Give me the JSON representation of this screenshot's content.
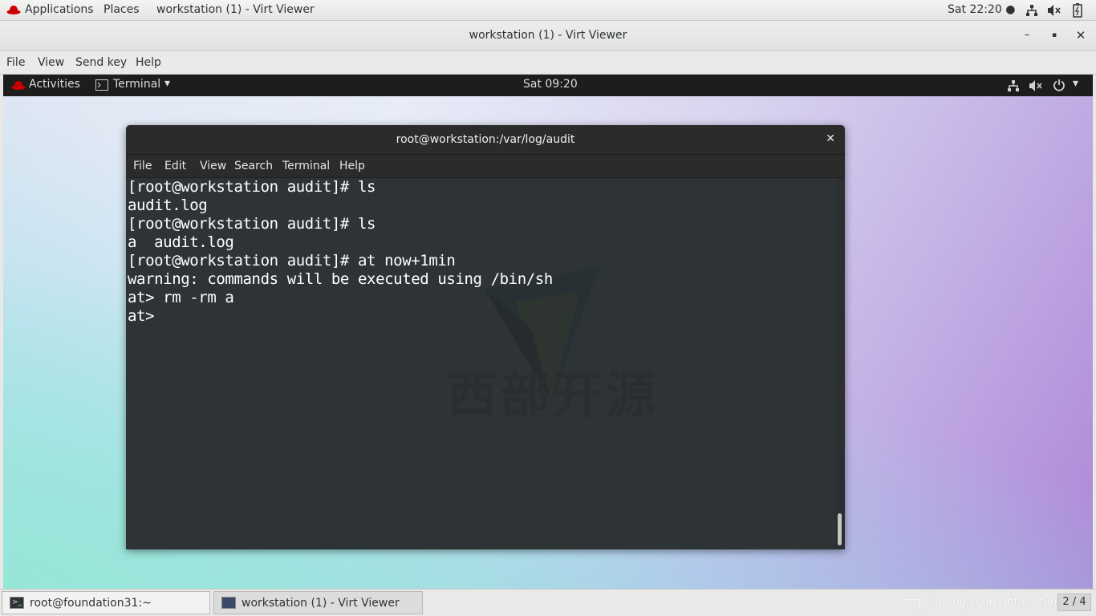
{
  "host_bar": {
    "applications": "Applications",
    "places": "Places",
    "window_title": "workstation (1) - Virt Viewer",
    "clock": "Sat 22:20 ●"
  },
  "viewer_window": {
    "title": "workstation (1) - Virt Viewer",
    "minimize": "–",
    "maximize": "▪",
    "close": "✕",
    "menu": [
      "File",
      "View",
      "Send key",
      "Help"
    ]
  },
  "guest": {
    "top_bar": {
      "activities": "Activities",
      "app_menu": "Terminal",
      "clock": "Sat 09:20"
    },
    "terminal": {
      "title": "root@workstation:/var/log/audit",
      "close": "✕",
      "menu": [
        "File",
        "Edit",
        "View",
        "Search",
        "Terminal",
        "Help"
      ],
      "lines": [
        "[root@workstation audit]# ls",
        "audit.log",
        "[root@workstation audit]# ls",
        "a  audit.log",
        "[root@workstation audit]# at now+1min",
        "warning: commands will be executed using /bin/sh",
        "at> rm -rm a",
        "at>"
      ],
      "watermark_text": "西部开源"
    }
  },
  "taskbar": {
    "tasks": [
      "root@foundation31:~",
      "workstation (1) - Virt Viewer"
    ],
    "overlay_url": "https://blog.csdn.net/chitung",
    "workspace": "2 / 4"
  },
  "icons": {
    "redhat": "redhat-logo-icon",
    "network": "network-icon",
    "volume": "volume-muted-icon",
    "battery": "battery-icon",
    "power": "power-icon",
    "terminal": "terminal-icon"
  }
}
